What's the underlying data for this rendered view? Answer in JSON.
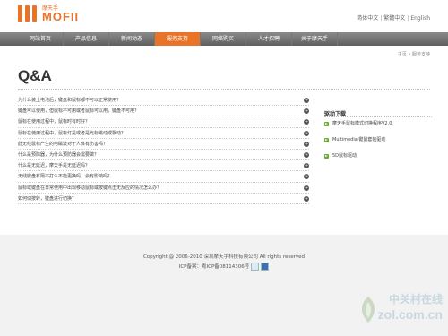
{
  "brand": {
    "tagline": "摩天手",
    "name": "MOFII"
  },
  "language_links": [
    "简体中文",
    "繁體中文",
    "English"
  ],
  "language_separator": "|",
  "nav": {
    "items": [
      {
        "label": "网站首页"
      },
      {
        "label": "产品信息"
      },
      {
        "label": "新闻动态"
      },
      {
        "label": "服务支持"
      },
      {
        "label": "网络购买"
      },
      {
        "label": "人才招聘"
      },
      {
        "label": "关于摩天手"
      }
    ],
    "active_index": 3
  },
  "breadcrumb": "主页 • 服务支持",
  "page_title": "Q&A",
  "faq": [
    {
      "question": "为什么装上电池后，键盘和鼠标都不可以正常使用？"
    },
    {
      "question": "键盘可以使用，但鼠标不可用或者鼠标可以用，键盘不可用？"
    },
    {
      "question": "鼠标在使用过程中，鼠标时有时好？"
    },
    {
      "question": "鼠标在使用过程中，鼠标灯是或者是光标跳动或飘动？"
    },
    {
      "question": "此无线鼠标产生的电磁波对于人体有伤害吗？"
    },
    {
      "question": "什么是预防器，为什么预防器会需要做？"
    },
    {
      "question": "什么是无延迟，摩天手是无延迟吗？"
    },
    {
      "question": "无线键盘有隔不打么不能更换吗，会有影响吗？"
    },
    {
      "question": "鼠标或键盘在日常使用中出现移动鼠标或按键点击无反应的情况怎么办？"
    },
    {
      "question": "如何切按转，键盘进行切换？"
    }
  ],
  "sidebar": {
    "title": "驱动下载",
    "items": [
      {
        "label": "摩天手鼠标模式切换程序V2.0"
      },
      {
        "label": "Multimedia 键鼠套装驱动"
      },
      {
        "label": "5D鼠标驱动"
      }
    ]
  },
  "footer": {
    "copyright": "Copyright @ 2006-2010 深圳摩天手科技有限公司  All rights reserved",
    "icp": "ICP备案：粤ICP备08114306号"
  },
  "watermark": {
    "cn": "中关村在线",
    "en": "zol.com.cn"
  },
  "colors": {
    "accent": "#e8742a",
    "nav_bg": "#6f6f6f",
    "sidebar_arrow": "#6aab2f",
    "footer_bg": "#f2f2f2"
  }
}
